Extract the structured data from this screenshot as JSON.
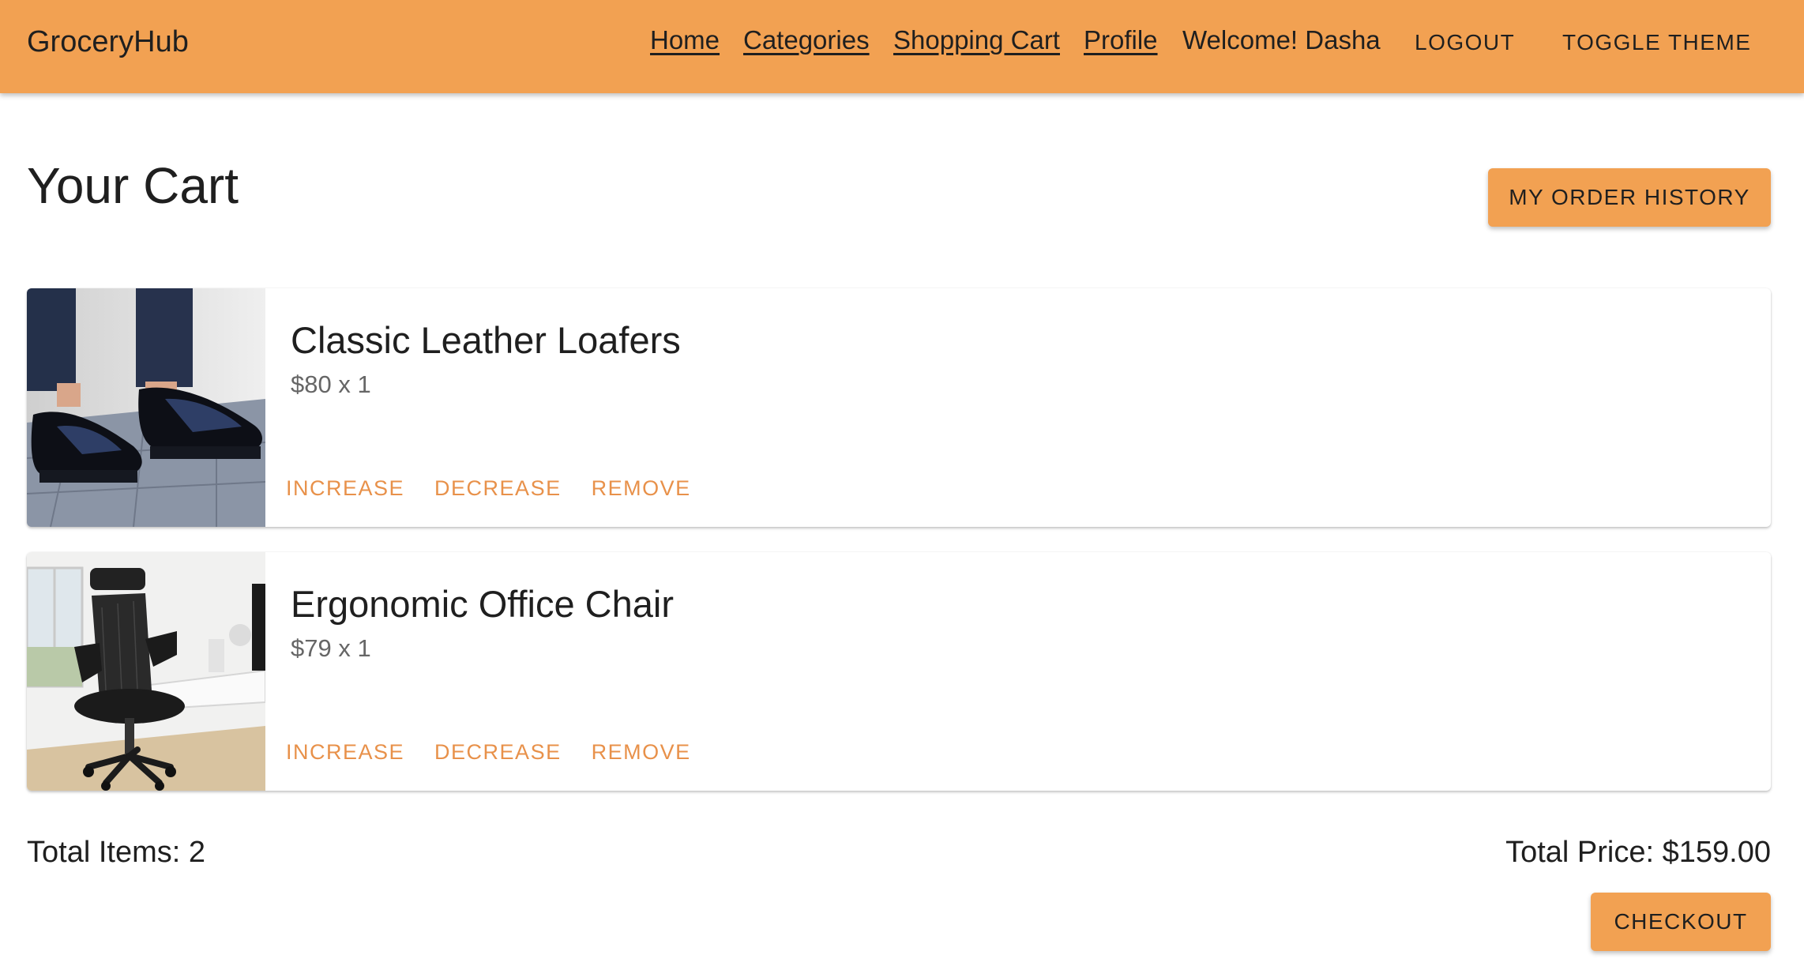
{
  "app": {
    "brand": "GroceryHub"
  },
  "nav": {
    "home": "Home",
    "categories": "Categories",
    "cart": "Shopping Cart",
    "profile": "Profile",
    "welcome": "Welcome! Dasha",
    "logout": "LOGOUT",
    "toggle_theme": "TOGGLE THEME"
  },
  "page": {
    "title": "Your Cart",
    "order_history": "MY ORDER HISTORY"
  },
  "items": [
    {
      "name": "Classic Leather Loafers",
      "price": "$80 x 1",
      "image": "loafers-photo"
    },
    {
      "name": "Ergonomic Office Chair",
      "price": "$79 x 1",
      "image": "office-chair-photo"
    }
  ],
  "actions": {
    "increase": "INCREASE",
    "decrease": "DECREASE",
    "remove": "REMOVE"
  },
  "summary": {
    "total_items": "Total Items: 2",
    "total_price": "Total Price: $159.00",
    "checkout": "CHECKOUT"
  },
  "colors": {
    "accent": "#f2a152",
    "action_text": "#e8914a"
  }
}
